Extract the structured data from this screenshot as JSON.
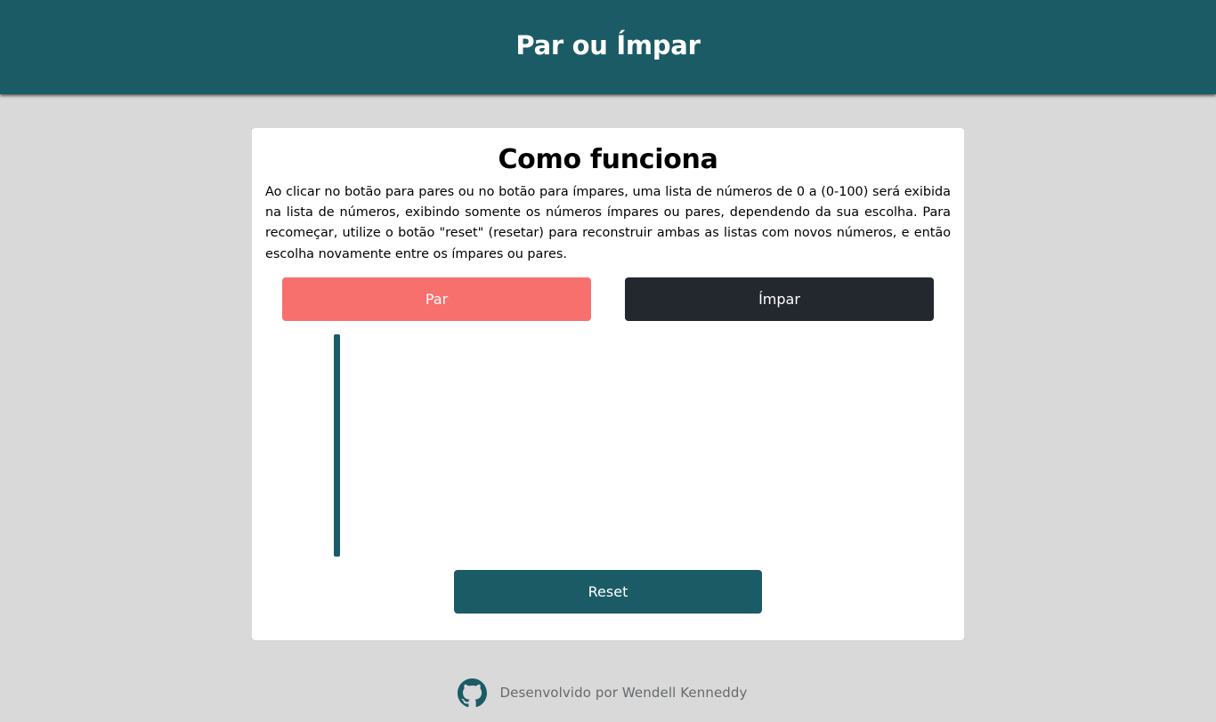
{
  "header": {
    "title": "Par ou Ímpar"
  },
  "card": {
    "title": "Como funciona",
    "description": "Ao clicar no botão para pares ou no botão para ímpares, uma lista de números de 0 a (0-100) será exibida na lista de números, exibindo somente os números ímpares ou pares, dependendo da sua escolha. Para recomeçar, utilize o botão \"reset\" (resetar) para reconstruir ambas as listas com novos números, e então escolha novamente entre os ímpares ou pares.",
    "buttons": {
      "par_label": "Par",
      "impar_label": "Ímpar",
      "reset_label": "Reset"
    },
    "numbers_list": []
  },
  "footer": {
    "icon": "github-icon",
    "credit": "Desenvolvido por Wendell Kenneddy"
  },
  "colors": {
    "primary": "#1b5b66",
    "par_button": "#f7706d",
    "impar_button": "#23282f",
    "background": "#d9d9d9"
  }
}
